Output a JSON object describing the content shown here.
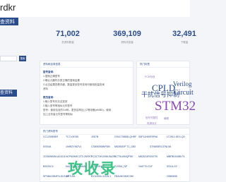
{
  "brand": {
    "text": "rdkr"
  },
  "header": {
    "title": "查资料"
  },
  "stats": [
    {
      "value": "71,002",
      "label": "总资料数量"
    },
    {
      "value": "369,109",
      "label": "资料浏览量"
    },
    {
      "value": "32,491",
      "label": "下载量"
    }
  ],
  "search": {
    "placeholder": "",
    "button_label": "搜索"
  },
  "side": {
    "pill_label": "查资料"
  },
  "info": {
    "title": "资料和目录信息",
    "lines": [
      {
        "text": "型号查询: ",
        "head": true
      },
      {
        "text": "1.搜索正确型号",
        "head": false
      },
      {
        "text": "2.确认元器件分类正确的搜索结果",
        "head": false
      },
      {
        "text": "3.点击结果查看详细，数量更多型号查询可使用批量查询",
        "head": false
      },
      {
        "text": "资料",
        "head": false
      },
      {
        "text": "",
        "head": false
      },
      {
        "text": "爬虫查询: ",
        "head": true
      },
      {
        "text": "1.输入型号仍无法查到",
        "head": false
      },
      {
        "text": "2.输入型号等相似元件型号",
        "head": false
      },
      {
        "text": "型号：使用包含的3-6码，更多结构加上Z等设备(eMBD)，使用",
        "head": false
      },
      {
        "text": "加上业务量元件型号等相似",
        "head": false
      }
    ]
  },
  "tags": {
    "title": "热门标签",
    "items": [
      {
        "text": "CPLD"
      },
      {
        "text": "Verilog"
      },
      {
        "text": "干扰信号抑制"
      },
      {
        "text": "Circuit"
      },
      {
        "text": "STM32"
      },
      {
        "text": "PCB布线"
      },
      {
        "text": "信号完整性"
      },
      {
        "text": "编程"
      },
      {
        "text": "电源设计"
      }
    ]
  },
  "parts": {
    "title": "热门资料型号",
    "rows": [
      [
        "CC1205EIBR",
        "TC7L0EGB",
        "J0S7B",
        "GS4C7B88D-QHRF",
        "S5P11N50F5P9A",
        "LT2510-SEX-Q3"
      ],
      [
        "SSS4A",
        "1N95ZYWZV1",
        "CS8060S8NPDB",
        "M53SM2P T1_G83",
        "STN6S5RL37NL5A",
        ""
      ],
      [
        "1DS696SIM-A010JL",
        "NCP609MC2T0-2NSKT",
        "RC3CTW100W-B4JR",
        "BCT9L654QPSK",
        "M82D24RG52TB",
        "MBRB1045B-F4"
      ],
      [
        "B2020C4",
        "NAC4500QQ8MAB",
        "FL00R4H0S",
        "FLRDA_NP",
        "1N4770-G1F",
        "SS1A-G2"
      ],
      [
        "SP38A1S84FN-SLS-1D",
        "MP7L5A",
        "BYU200U-12LB-1",
        "FBA4HGW3C0M",
        "",
        "CB8060D"
      ]
    ]
  },
  "watermark": {
    "text": "攻收录"
  }
}
